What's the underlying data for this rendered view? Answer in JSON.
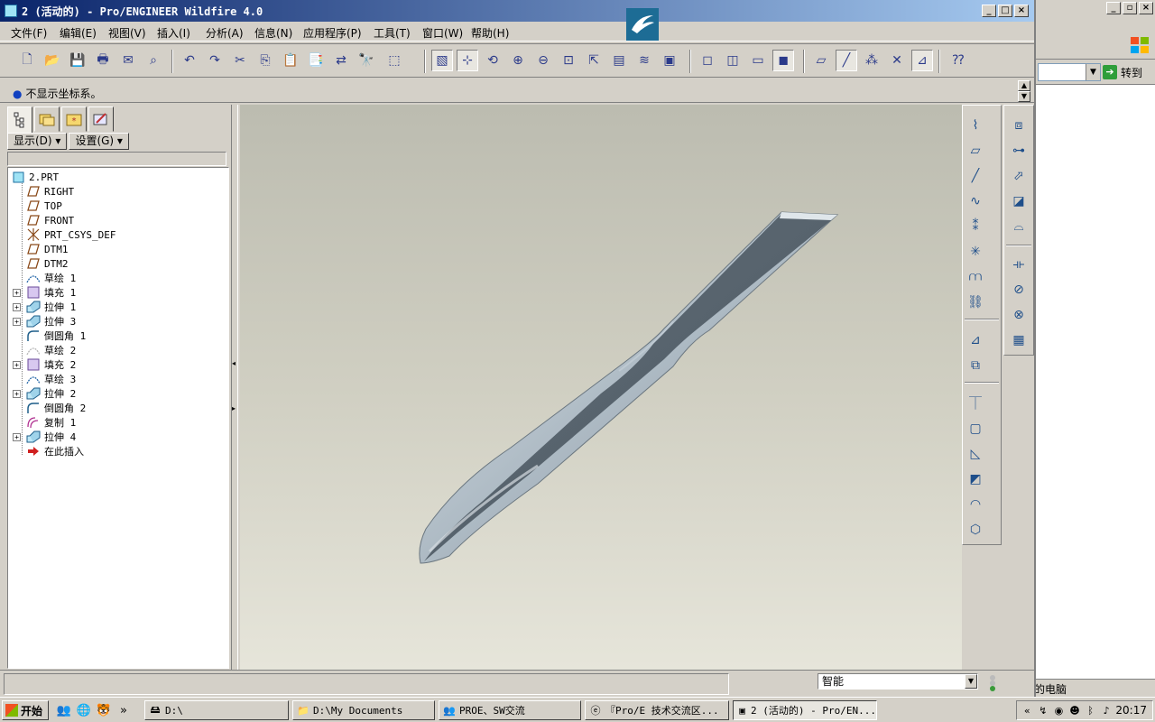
{
  "window": {
    "title": "2 (活动的) - Pro/ENGINEER Wildfire 4.0"
  },
  "menu": [
    "文件(F)",
    "编辑(E)",
    "视图(V)",
    "插入(I)",
    "分析(A)",
    "信息(N)",
    "应用程序(P)",
    "工具(T)",
    "窗口(W)",
    "帮助(H)"
  ],
  "toolbar": {
    "icons": [
      "new-icon",
      "open-icon",
      "save-icon",
      "print-icon",
      "send-mail-icon",
      "send-link-icon",
      "undo-icon",
      "redo-icon",
      "cut-icon",
      "copy-icon",
      "paste-icon",
      "paste-special-icon",
      "regenerate-icon",
      "find-icon",
      "select-box-icon",
      "repaint-icon",
      "spin-center-icon",
      "orient-icon",
      "zoom-in-icon",
      "zoom-out-icon",
      "refit-icon",
      "reorient-icon",
      "saved-views-icon",
      "layers-icon",
      "view-manager-icon",
      "wireframe-icon",
      "hidden-line-icon",
      "no-hidden-icon",
      "shading-icon",
      "datum-plane-display-icon",
      "datum-axis-display-icon",
      "datum-point-display-icon",
      "csys-display-icon",
      "annotation-display-icon",
      "context-help-icon"
    ]
  },
  "message": {
    "text": "不显示坐标系。",
    "color": "#1040c0"
  },
  "nav": {
    "tabs": [
      "model-tree-tab",
      "folder-browser-tab",
      "favorites-tab",
      "connections-tab"
    ],
    "show_btn": "显示(D) ▾",
    "settings_btn": "设置(G) ▾"
  },
  "tree": {
    "root": "2.PRT",
    "items": [
      {
        "label": "RIGHT",
        "icon": "datum-plane-icon",
        "expandable": false
      },
      {
        "label": "TOP",
        "icon": "datum-plane-icon",
        "expandable": false
      },
      {
        "label": "FRONT",
        "icon": "datum-plane-icon",
        "expandable": false
      },
      {
        "label": "PRT_CSYS_DEF",
        "icon": "csys-icon",
        "expandable": false
      },
      {
        "label": "DTM1",
        "icon": "datum-plane-icon",
        "expandable": false
      },
      {
        "label": "DTM2",
        "icon": "datum-plane-icon",
        "expandable": false
      },
      {
        "label": "草绘 1",
        "icon": "sketch-icon",
        "expandable": false
      },
      {
        "label": "填充 1",
        "icon": "fill-icon",
        "expandable": true
      },
      {
        "label": "拉伸 1",
        "icon": "extrude-icon",
        "expandable": true
      },
      {
        "label": "拉伸 3",
        "icon": "extrude-icon",
        "expandable": true
      },
      {
        "label": "倒圆角 1",
        "icon": "round-icon",
        "expandable": false
      },
      {
        "label": "草绘 2",
        "icon": "sketch-hidden-icon",
        "expandable": false
      },
      {
        "label": "填充 2",
        "icon": "fill-icon",
        "expandable": true
      },
      {
        "label": "草绘 3",
        "icon": "sketch-icon",
        "expandable": false
      },
      {
        "label": "拉伸 2",
        "icon": "extrude-icon",
        "expandable": true
      },
      {
        "label": "倒圆角 2",
        "icon": "round-icon",
        "expandable": false
      },
      {
        "label": "复制 1",
        "icon": "copy-feature-icon",
        "expandable": false
      },
      {
        "label": "拉伸 4",
        "icon": "extrude-icon",
        "expandable": true
      },
      {
        "label": "在此插入",
        "icon": "insert-here-icon",
        "expandable": false
      }
    ]
  },
  "right_toolbar": {
    "col1": [
      "datum-sketch-icon",
      "datum-plane-icon",
      "datum-axis-icon",
      "datum-curve-icon",
      "datum-point-icon",
      "datum-csys-icon",
      "analysis-feature-icon",
      "connect-icon",
      "annotation-icon",
      "copy-geom-icon",
      "hole-icon",
      "shell-icon",
      "rib-icon",
      "draft-icon",
      "round-icon",
      "chamfer-icon"
    ],
    "col2": [
      "extrude-icon",
      "revolve-icon",
      "sweep-icon",
      "blend-icon",
      "style-icon",
      "mirror-icon",
      "merge-icon",
      "trim-icon",
      "pattern-icon"
    ]
  },
  "status": {
    "filter_value": "智能",
    "light_color": "#3a9a3a"
  },
  "bg_window": {
    "go_label": "转到",
    "bottom_text": "的电脑"
  },
  "taskbar": {
    "start_label": "开始",
    "tasks": [
      {
        "label": "D:\\",
        "icon": "drive-icon",
        "active": false
      },
      {
        "label": "D:\\My Documents",
        "icon": "folder-icon",
        "active": false
      },
      {
        "label": "PROE、SW交流",
        "icon": "chat-icon",
        "active": false
      },
      {
        "label": "『Pro/E 技术交流区...",
        "icon": "ie-icon",
        "active": false
      },
      {
        "label": "2 (活动的) - Pro/EN...",
        "icon": "proe-icon",
        "active": true
      }
    ],
    "clock": "20:17"
  }
}
